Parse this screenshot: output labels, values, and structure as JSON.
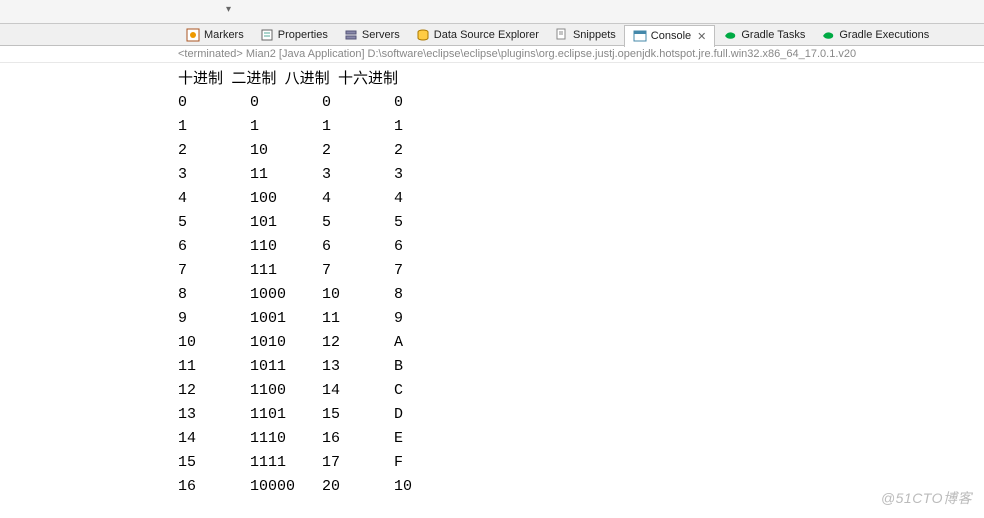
{
  "toolbar": {
    "dropdown_arrow": "▾"
  },
  "tabs": [
    {
      "label": "Markers"
    },
    {
      "label": "Properties"
    },
    {
      "label": "Servers"
    },
    {
      "label": "Data Source Explorer"
    },
    {
      "label": "Snippets"
    },
    {
      "label": "Console",
      "active": true,
      "closable": true
    },
    {
      "label": "Gradle Tasks"
    },
    {
      "label": "Gradle Executions"
    }
  ],
  "termination": "<terminated> Mian2 [Java Application] D:\\software\\eclipse\\eclipse\\plugins\\org.eclipse.justj.openjdk.hotspot.jre.full.win32.x86_64_17.0.1.v20",
  "columns": [
    "十进制",
    "二进制",
    "八进制",
    "十六进制"
  ],
  "chart_data": {
    "type": "table",
    "columns": [
      "十进制",
      "二进制",
      "八进制",
      "十六进制"
    ],
    "rows": [
      [
        "0",
        "0",
        "0",
        "0"
      ],
      [
        "1",
        "1",
        "1",
        "1"
      ],
      [
        "2",
        "10",
        "2",
        "2"
      ],
      [
        "3",
        "11",
        "3",
        "3"
      ],
      [
        "4",
        "100",
        "4",
        "4"
      ],
      [
        "5",
        "101",
        "5",
        "5"
      ],
      [
        "6",
        "110",
        "6",
        "6"
      ],
      [
        "7",
        "111",
        "7",
        "7"
      ],
      [
        "8",
        "1000",
        "10",
        "8"
      ],
      [
        "9",
        "1001",
        "11",
        "9"
      ],
      [
        "10",
        "1010",
        "12",
        "A"
      ],
      [
        "11",
        "1011",
        "13",
        "B"
      ],
      [
        "12",
        "1100",
        "14",
        "C"
      ],
      [
        "13",
        "1101",
        "15",
        "D"
      ],
      [
        "14",
        "1110",
        "16",
        "E"
      ],
      [
        "15",
        "1111",
        "17",
        "F"
      ],
      [
        "16",
        "10000",
        "20",
        "10"
      ]
    ]
  },
  "watermark": "@51CTO博客"
}
